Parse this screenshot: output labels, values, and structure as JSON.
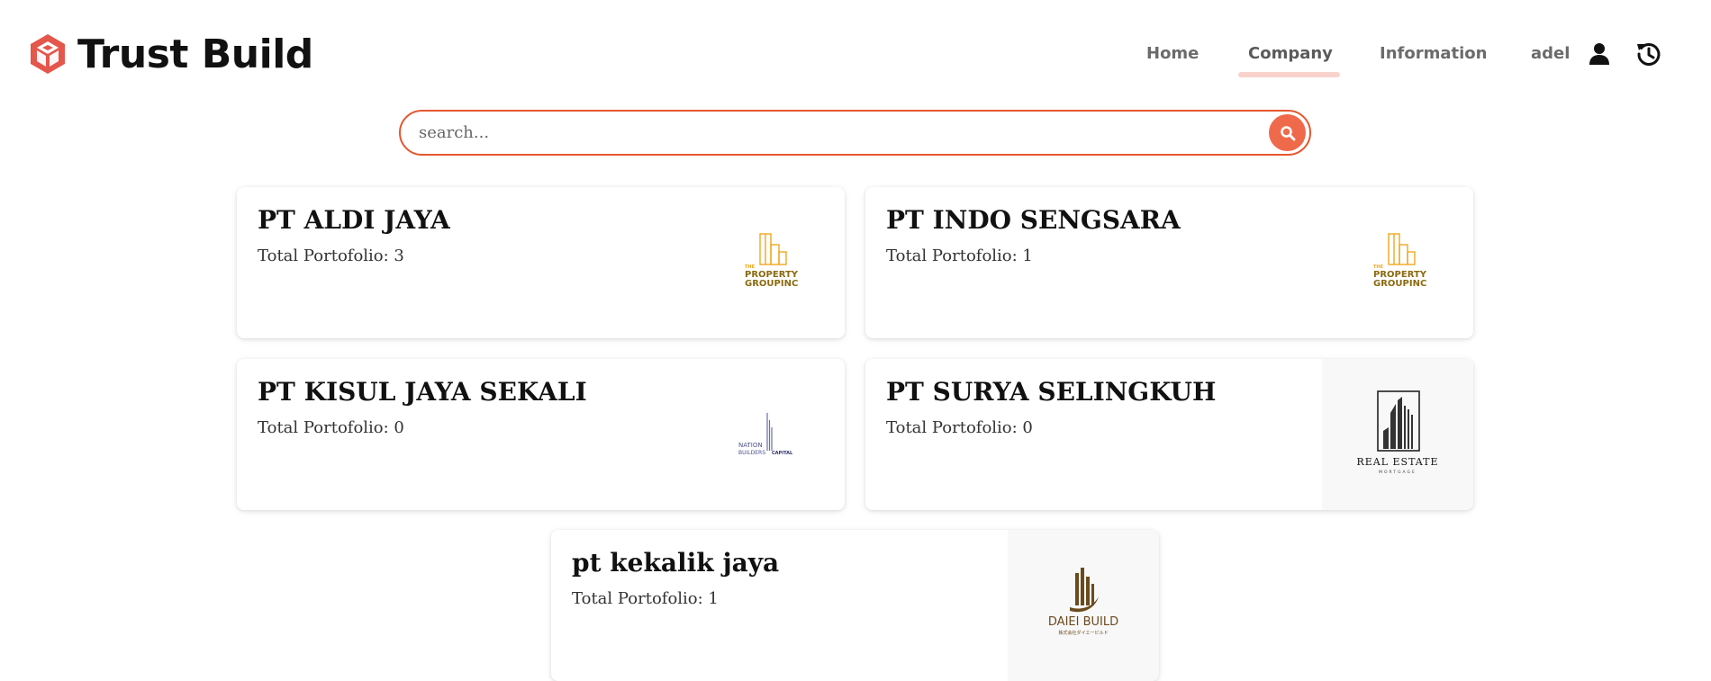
{
  "brand": {
    "name": "Trust Build",
    "logo_icon": "cube-logo-icon",
    "accent": "#e4574c"
  },
  "nav": {
    "items": [
      {
        "label": "Home",
        "active": false
      },
      {
        "label": "Company",
        "active": true
      },
      {
        "label": "Information",
        "active": false
      },
      {
        "label": "adel",
        "active": false
      }
    ],
    "user_icon": "user-icon",
    "history_icon": "history-icon"
  },
  "search": {
    "placeholder": "search...",
    "button_icon": "search-icon",
    "border_color": "#e4572e",
    "button_color": "#ef6a4b"
  },
  "companies": [
    {
      "name": "PT ALDI JAYA",
      "portfolio": "Total Portofolio: 3",
      "logo": "the-property-group-logo",
      "logo_text": [
        "THE",
        "PROPERTY",
        "GROUPINC."
      ]
    },
    {
      "name": "PT INDO SENGSARA",
      "portfolio": "Total Portofolio: 1",
      "logo": "the-property-group-logo",
      "logo_text": [
        "THE",
        "PROPERTY",
        "GROUPINC."
      ]
    },
    {
      "name": "PT KISUL JAYA SEKALI",
      "portfolio": "Total Portofolio: 0",
      "logo": "nation-builders-capital-logo",
      "logo_text": [
        "NATION",
        "BUILDERS",
        "CAPITAL"
      ]
    },
    {
      "name": "PT SURYA SELINGKUH",
      "portfolio": "Total Portofolio: 0",
      "logo": "real-estate-mortgage-logo",
      "logo_text": [
        "REAL ESTATE",
        "MORTGAGE"
      ]
    },
    {
      "name": "pt kekalik jaya",
      "portfolio": "Total Portofolio: 1",
      "logo": "daiei-build-logo",
      "logo_text": [
        "DAIEI BUILD",
        "株式会社ダイエービルド"
      ]
    }
  ]
}
